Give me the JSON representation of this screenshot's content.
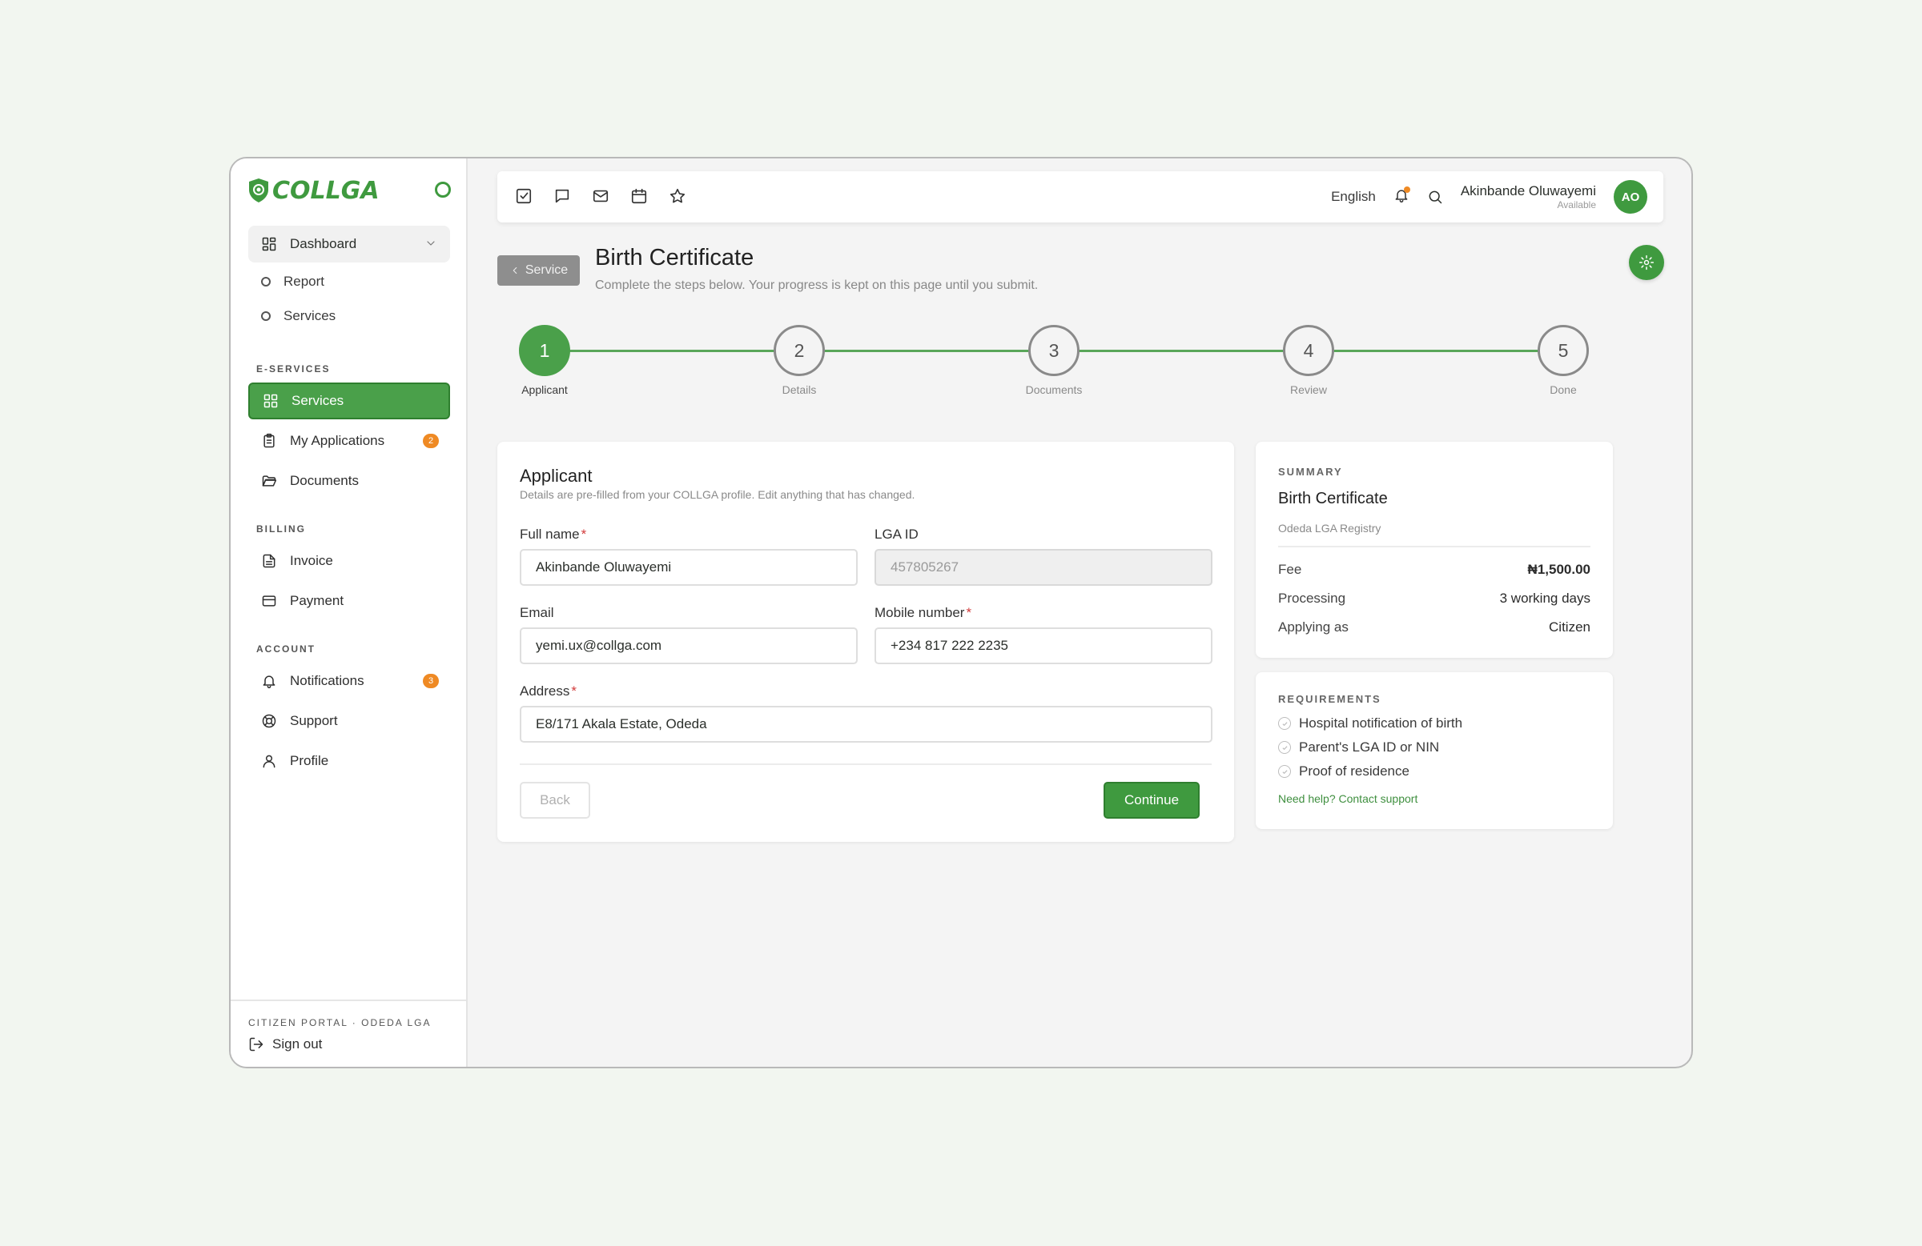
{
  "brand": {
    "name": "COLLGA",
    "tagline": ""
  },
  "sidebar": {
    "dashboard": "Dashboard",
    "subnav": [
      "Report",
      "Services"
    ],
    "eservices_label": "E-SERVICES",
    "eservices": [
      {
        "label": "Services",
        "badge": ""
      },
      {
        "label": "My Applications",
        "badge": "2"
      },
      {
        "label": "Documents",
        "badge": ""
      }
    ],
    "billing_label": "BILLING",
    "billing": [
      {
        "label": "Invoice"
      },
      {
        "label": "Payment"
      }
    ],
    "account_label": "ACCOUNT",
    "account": [
      {
        "label": "Notifications",
        "badge": "3"
      },
      {
        "label": "Support"
      },
      {
        "label": "Profile"
      }
    ],
    "footer": {
      "portal": "CITIZEN PORTAL · ODEDA LGA",
      "signout": "Sign out"
    }
  },
  "topbar": {
    "language": "English",
    "user": {
      "name": "Akinbande Oluwayemi",
      "status": "Available",
      "initials": "AO"
    }
  },
  "header": {
    "back_label": "Service",
    "title": "Birth Certificate",
    "subtitle": "Complete the steps below. Your progress is kept on this page until you submit."
  },
  "stepper": {
    "current": 1,
    "steps": [
      {
        "number": "1",
        "label": "Applicant"
      },
      {
        "number": "2",
        "label": "Details"
      },
      {
        "number": "3",
        "label": "Documents"
      },
      {
        "number": "4",
        "label": "Review"
      },
      {
        "number": "5",
        "label": "Done"
      }
    ]
  },
  "form": {
    "title": "Applicant",
    "subtitle": "Details are pre-filled from your COLLGA profile. Edit anything that has changed.",
    "full_name": {
      "label": "Full name",
      "value": "Akinbande Oluwayemi"
    },
    "lga_id": {
      "label": "LGA ID",
      "value": "457805267"
    },
    "email": {
      "label": "Email",
      "value": "yemi.ux@collga.com"
    },
    "mobile": {
      "label": "Mobile number",
      "value": "+234 817 222 2235"
    },
    "address": {
      "label": "Address",
      "value": "E8/171 Akala Estate, Odeda"
    },
    "required_mark": "*",
    "back_label": "Back",
    "continue_label": "Continue"
  },
  "summary": {
    "label": "SUMMARY",
    "title": "Birth Certificate",
    "registry": "Odeda LGA Registry",
    "rows": [
      {
        "key": "Fee",
        "value": "₦1,500.00"
      },
      {
        "key": "Processing",
        "value": "3 working days"
      },
      {
        "key": "Applying as",
        "value": "Citizen"
      }
    ]
  },
  "requirements": {
    "label": "REQUIREMENTS",
    "items": [
      "Hospital notification of birth",
      "Parent's LGA ID or NIN",
      "Proof of residence"
    ],
    "help": "Need help? Contact support"
  },
  "colors": {
    "accent": "#3f9a3f",
    "badge": "#ef8a24",
    "required": "#d23b3b"
  }
}
